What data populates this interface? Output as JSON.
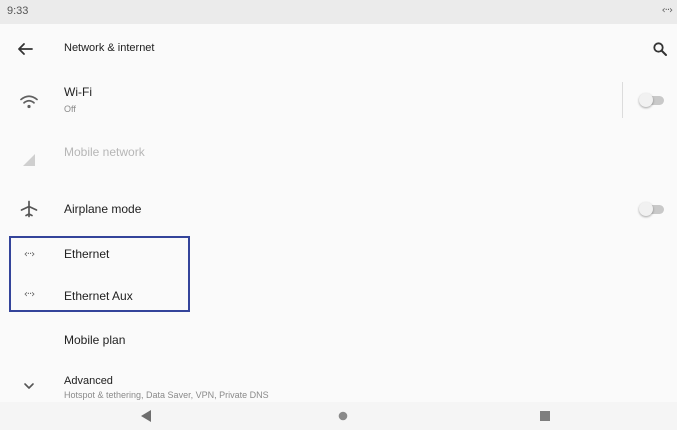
{
  "status_bar": {
    "time": "9:33",
    "ethernet_glyph": "‹··›"
  },
  "toolbar": {
    "title": "Network & internet",
    "back_icon": "arrow-back-icon",
    "search_icon": "search-icon"
  },
  "settings": [
    {
      "key": "wifi",
      "title": "Wi-Fi",
      "summary": "Off",
      "icon": "wifi-icon",
      "toggle": "off",
      "enabled": true
    },
    {
      "key": "mobile_network",
      "title": "Mobile network",
      "icon": "signal-icon",
      "enabled": false
    },
    {
      "key": "airplane",
      "title": "Airplane mode",
      "icon": "airplane-icon",
      "toggle": "off",
      "enabled": true
    },
    {
      "key": "ethernet",
      "title": "Ethernet",
      "icon": "ethernet-icon",
      "glyph": "‹··›",
      "enabled": true
    },
    {
      "key": "ethernet_aux",
      "title": "Ethernet Aux",
      "icon": "ethernet-icon",
      "glyph": "‹··›",
      "enabled": true
    },
    {
      "key": "mobile_plan",
      "title": "Mobile plan",
      "enabled": true
    },
    {
      "key": "advanced",
      "title": "Advanced",
      "summary": "Hotspot & tethering, Data Saver, VPN, Private DNS",
      "icon": "chevron-down-icon",
      "enabled": true
    }
  ],
  "highlight_color": "#34449a",
  "nav_bar": {
    "buttons": [
      "back-triangle-icon",
      "home-circle-icon",
      "recents-square-icon"
    ]
  }
}
